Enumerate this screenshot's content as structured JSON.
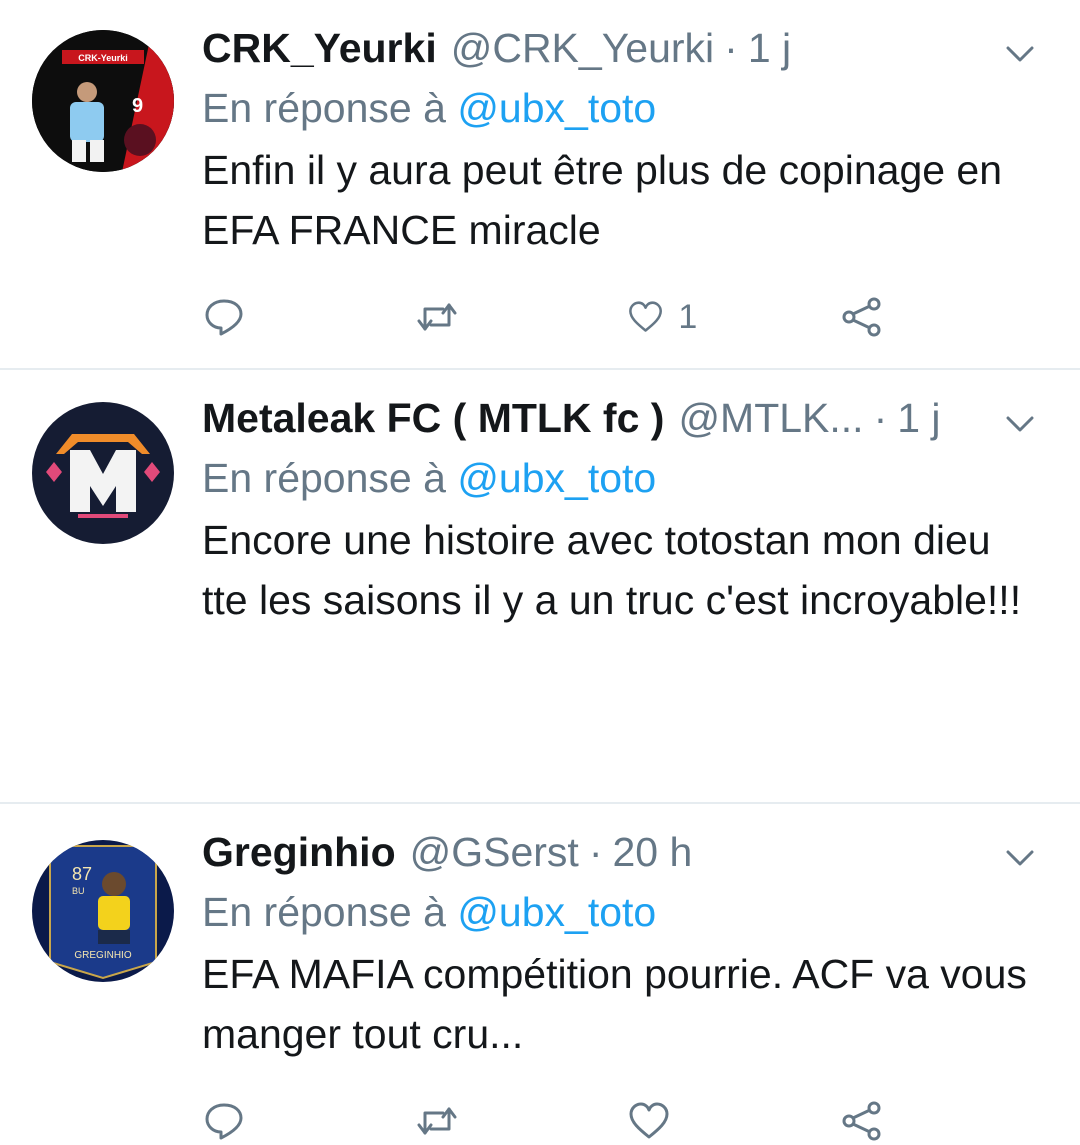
{
  "tweets": [
    {
      "name": "CRK_Yeurki",
      "handle": "@CRK_Yeurki",
      "time": "1 j",
      "reply_prefix": "En réponse à",
      "reply_to": "@ubx_toto",
      "text": "Enfin il y aura peut être plus de copinage en EFA FRANCE miracle",
      "likes": "1",
      "avatar_label": "CRK-Yeurki"
    },
    {
      "name": "Metaleak FC ( MTLK fc )",
      "handle": "@MTLK...",
      "time": "1 j",
      "reply_prefix": "En réponse à",
      "reply_to": "@ubx_toto",
      "text": "Encore une histoire avec totostan mon dieu tte les saisons il y a un truc c'est incroyable!!!",
      "likes": ""
    },
    {
      "name": "Greginhio",
      "handle": "@GSerst",
      "time": "20 h",
      "reply_prefix": "En réponse à",
      "reply_to": "@ubx_toto",
      "text": "EFA MAFIA compétition pourrie. ACF va vous manger tout cru...",
      "avatar_label": "GREGINHIO",
      "avatar_rating": "87",
      "avatar_pos": "BU"
    }
  ],
  "colors": {
    "primary_text": "#14171a",
    "secondary_text": "#657786",
    "link": "#1da1f2",
    "divider": "#e6ecf0"
  },
  "icons": [
    "reply-icon",
    "retweet-icon",
    "like-icon",
    "share-icon",
    "chevron-down-icon"
  ]
}
